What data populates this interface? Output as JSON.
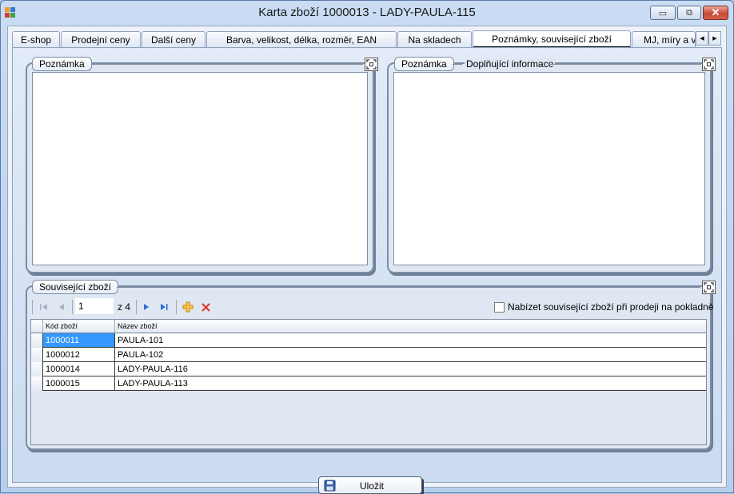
{
  "window": {
    "title": "Karta zboží 1000013  -  LADY-PAULA-115",
    "minimize_glyph": "▭",
    "restore_glyph": "⧉",
    "close_glyph": "✕"
  },
  "tabs": [
    {
      "label": "E-shop",
      "active": false
    },
    {
      "label": "Prodejní ceny",
      "active": false
    },
    {
      "label": "Další ceny",
      "active": false
    },
    {
      "label": "Barva, velikost, délka, rozměr, EAN",
      "active": false
    },
    {
      "label": "Na skladech",
      "active": false
    },
    {
      "label": "Poznámky, související zboží",
      "active": true
    },
    {
      "label": "MJ, míry a v",
      "active": false
    }
  ],
  "tab_scroll": {
    "left_glyph": "◀",
    "right_glyph": "▶"
  },
  "note_left": {
    "label": "Poznámka",
    "value": ""
  },
  "note_right": {
    "label": "Poznámka",
    "secondary_label": "Doplňující informace",
    "value": ""
  },
  "related": {
    "label": "Související zboží",
    "navigator": {
      "current_page": "1",
      "of_text": "z 4"
    },
    "checkbox": {
      "label": "Nabízet související zboží při prodeji na pokladně",
      "checked": false
    },
    "columns": [
      "Kód zboží",
      "Název zboží"
    ],
    "rows": [
      {
        "code": "1000011",
        "name": "PAULA-101",
        "selected": true
      },
      {
        "code": "1000012",
        "name": "PAULA-102",
        "selected": false
      },
      {
        "code": "1000014",
        "name": "LADY-PAULA-116",
        "selected": false
      },
      {
        "code": "1000015",
        "name": "LADY-PAULA-113",
        "selected": false
      }
    ]
  },
  "save_button": {
    "label": "Uložit"
  },
  "colors": {
    "selection": "#3399ff",
    "delete_icon": "#e03020",
    "add_icon": "#f0a020",
    "nav_icon": "#2a6fd6"
  }
}
